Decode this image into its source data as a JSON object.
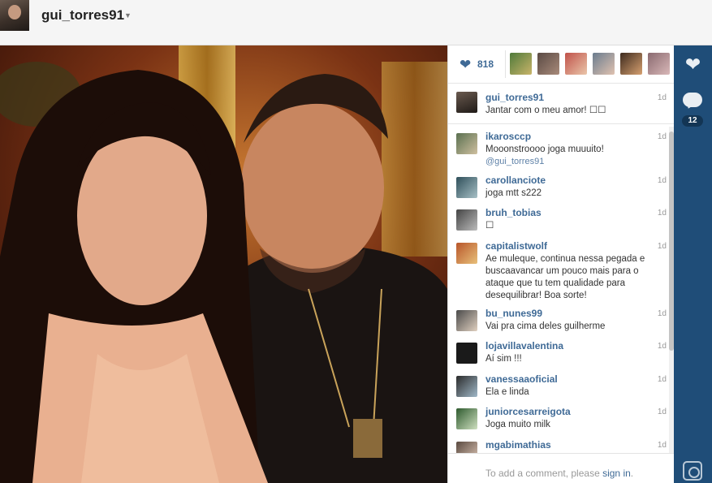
{
  "header": {
    "username": "gui_torres91",
    "caret_icon": "chevron-down-icon"
  },
  "likes": {
    "icon": "heart-icon",
    "count": "818"
  },
  "caption": {
    "user": "gui_torres91",
    "text": "Jantar com o meu amor! ☐☐",
    "age": "1d"
  },
  "comments": [
    {
      "user": "ikarosccp",
      "text": "Mooonstroooo joga muuuito!",
      "mention": "@gui_torres91",
      "age": "1d"
    },
    {
      "user": "carollanciote",
      "text": "joga mtt s222",
      "age": "1d"
    },
    {
      "user": "bruh_tobias",
      "text": "☐",
      "age": "1d"
    },
    {
      "user": "capitalistwolf",
      "text": "Ae muleque, continua nessa pegada e buscaavancar um pouco mais para o ataque que tu tem qualidade para desequilibrar! Boa sorte!",
      "age": "1d"
    },
    {
      "user": "bu_nunes99",
      "text": "Vai pra cima deles guilherme",
      "age": "1d"
    },
    {
      "user": "lojavillavalentina",
      "text": "Aí sim !!!",
      "age": "1d"
    },
    {
      "user": "vanessaaoficial",
      "text": "Ela e linda",
      "age": "1d"
    },
    {
      "user": "juniorcesarreigota",
      "text": "Joga muito milk",
      "age": "1d"
    },
    {
      "user": "mgabimathias",
      "text": "",
      "age": "1d"
    }
  ],
  "add_comment": {
    "prefix": "To add a comment, please ",
    "link": "sign in",
    "suffix": "."
  },
  "rail": {
    "like_icon": "heart-icon",
    "comment_icon": "speech-bubble-icon",
    "comment_count": "12",
    "camera_icon": "camera-icon"
  },
  "colors": {
    "accent": "#3f6a96",
    "rail": "#1f4d78"
  }
}
